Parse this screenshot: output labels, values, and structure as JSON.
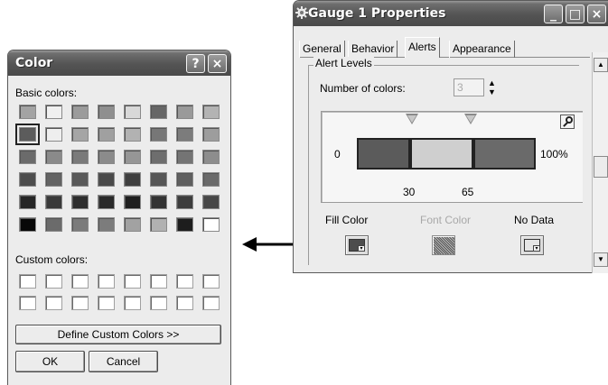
{
  "color_dialog": {
    "title": "Color",
    "help_button": "?",
    "close_button": "×",
    "basic_colors_label": "Basic colors:",
    "custom_colors_label": "Custom colors:",
    "define_custom_label": "Define Custom Colors >>",
    "ok_label": "OK",
    "cancel_label": "Cancel",
    "basic_colors": [
      [
        "#a3a3a3",
        "#f0f0f0",
        "#9b9b9b",
        "#8f8f8f",
        "#d8d8d8",
        "#666666",
        "#9a9a9a",
        "#b3b3b3"
      ],
      [
        "#5c5c5c",
        "#eeeeee",
        "#a5a5a5",
        "#a0a0a0",
        "#b2b2b2",
        "#777777",
        "#7c7c7c",
        "#9d9d9d"
      ],
      [
        "#6b6b6b",
        "#8a8a8a",
        "#7a7a7a",
        "#8b8b8b",
        "#969696",
        "#6e6e6e",
        "#747474",
        "#8d8d8d"
      ],
      [
        "#4d4d4d",
        "#636363",
        "#5a5a5a",
        "#4a4a4a",
        "#3f3f3f",
        "#565656",
        "#5f5f5f",
        "#6a6a6a"
      ],
      [
        "#262626",
        "#3a3a3a",
        "#2e2e2e",
        "#2a2a2a",
        "#1f1f1f",
        "#333333",
        "#3d3d3d",
        "#474747"
      ],
      [
        "#080808",
        "#6b6b6b",
        "#7b7b7b",
        "#7c7c7c",
        "#a2a2a2",
        "#b1b1b1",
        "#1d1d1d",
        "#ffffff"
      ]
    ],
    "selected_color": "row 2, column 1"
  },
  "gauge_window": {
    "title": "Gauge 1 Properties",
    "minimize_label": "_",
    "maximize_label": "□",
    "close_label": "×",
    "tabs": [
      "General",
      "Behavior",
      "Alerts",
      "Appearance"
    ],
    "active_tab": "Alerts",
    "alert_levels_label": "Alert Levels",
    "number_of_colors_label": "Number of colors:",
    "number_of_colors_value": "3",
    "gauge_min_label": "0",
    "gauge_max_label": "100%",
    "threshold_1": "30",
    "threshold_2": "65",
    "segments": [
      {
        "from": 0,
        "to": 30,
        "color": "#5b5b5b"
      },
      {
        "from": 30,
        "to": 65,
        "color": "#cfcfcf"
      },
      {
        "from": 65,
        "to": 100,
        "color": "#6a6a6a"
      }
    ],
    "fill_color_label": "Fill Color",
    "font_color_label": "Font Color",
    "no_data_label": "No Data",
    "fill_color_value": "#4d4d4d",
    "no_data_color_value": "#e6e6e6"
  },
  "icons": {
    "gear": "gear-icon",
    "zoom": "zoom-icon",
    "arrow": "double-headed-arrow"
  }
}
